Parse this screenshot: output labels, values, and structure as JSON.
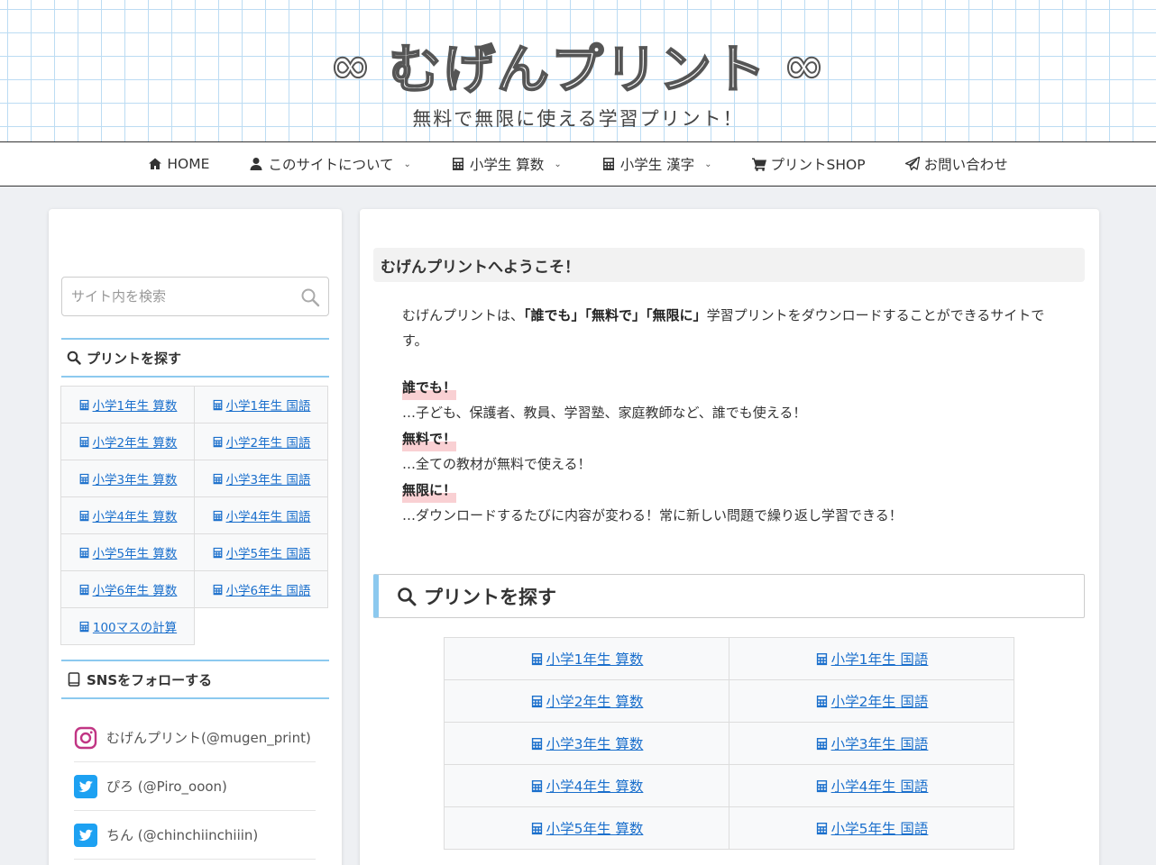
{
  "header": {
    "logo_symbol": "∞",
    "title": "むげんプリント",
    "tagline": "無料で無限に使える学習プリント！"
  },
  "nav": {
    "items": [
      {
        "label": "HOME",
        "icon": "home-icon",
        "has_caret": false
      },
      {
        "label": "このサイトについて",
        "icon": "user-icon",
        "has_caret": true
      },
      {
        "label": "小学生 算数",
        "icon": "calculator-icon",
        "has_caret": true
      },
      {
        "label": "小学生 漢字",
        "icon": "calculator-icon",
        "has_caret": true
      },
      {
        "label": "プリントSHOP",
        "icon": "cart-icon",
        "has_caret": false
      },
      {
        "label": "お問い合わせ",
        "icon": "paper-plane-icon",
        "has_caret": false
      }
    ]
  },
  "sidebar": {
    "search": {
      "placeholder": "サイト内を検索",
      "value": ""
    },
    "print_widget": {
      "title": "プリントを探す",
      "links": [
        "小学1年生 算数",
        "小学1年生 国語",
        "小学2年生 算数",
        "小学2年生 国語",
        "小学3年生 算数",
        "小学3年生 国語",
        "小学4年生 算数",
        "小学4年生 国語",
        "小学5年生 算数",
        "小学5年生 国語",
        "小学6年生 算数",
        "小学6年生 国語",
        "100マスの計算"
      ]
    },
    "sns_widget": {
      "title": "SNSをフォローする",
      "items": [
        {
          "label": "むげんプリント(@mugen_print)",
          "icon": "instagram-icon"
        },
        {
          "label": "ぴろ (@Piro_ooon)",
          "icon": "twitter-icon"
        },
        {
          "label": "ちん (@chinchiinchiiin)",
          "icon": "twitter-icon"
        }
      ]
    }
  },
  "main": {
    "welcome_heading": "むげんプリントへようこそ！",
    "intro": {
      "prefix": "むげんプリントは、",
      "kw1": "「誰でも」",
      "kw2": "「無料で」",
      "kw3": "「無限に」",
      "suffix": "学習プリントをダウンロードすることができるサイトです。"
    },
    "features": [
      {
        "title": "誰でも！",
        "desc": "…子ども、保護者、教員、学習塾、家庭教師など、誰でも使える！"
      },
      {
        "title": "無料で！",
        "desc": "…全ての教材が無料で使える！"
      },
      {
        "title": "無限に！",
        "desc": "…ダウンロードするたびに内容が変わる！常に新しい問題で繰り返し学習できる！"
      }
    ],
    "section_heading": "プリントを探す",
    "links": [
      "小学1年生 算数",
      "小学1年生 国語",
      "小学2年生 算数",
      "小学2年生 国語",
      "小学3年生 算数",
      "小学3年生 国語",
      "小学4年生 算数",
      "小学4年生 国語",
      "小学5年生 算数",
      "小学5年生 国語"
    ]
  },
  "colors": {
    "link": "#1a6fcc",
    "accent_blue": "#8cc9ef",
    "highlight_pink": "#f9d0d3",
    "grid_line": "#bcdcf3"
  }
}
